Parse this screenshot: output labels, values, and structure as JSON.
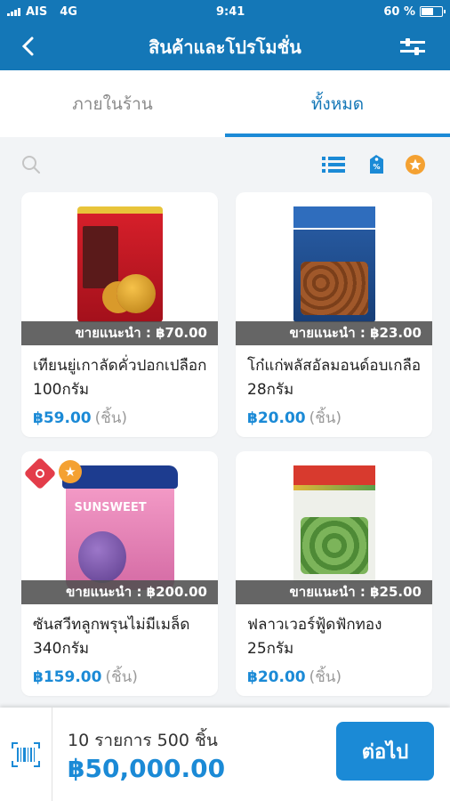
{
  "status_bar": {
    "carrier": "AIS",
    "network": "4G",
    "time": "9:41",
    "battery": "60 %",
    "battery_level": 0.6
  },
  "header": {
    "title": "สินค้าและโปรโมชั่น"
  },
  "tabs": [
    {
      "label": "ภายในร้าน",
      "active": false
    },
    {
      "label": "ทั้งหมด",
      "active": true
    }
  ],
  "products": [
    {
      "name": "เทียนยู่เกาลัดคั่วปอกเปลือก 100กรัม",
      "recommended": "ขายแนะนำ : ฿70.00",
      "price": "฿59.00",
      "unit": "(ชิ้น)"
    },
    {
      "name": "โก๋แก่พลัสอัลมอนด์อบเกลือ 28กรัม",
      "recommended": "ขายแนะนำ : ฿23.00",
      "price": "฿20.00",
      "unit": "(ชิ้น)"
    },
    {
      "name": "ซันสวีทลูกพรุนไม่มีเมล็ด 340กรัม",
      "recommended": "ขายแนะนำ : ฿200.00",
      "price": "฿159.00",
      "unit": "(ชิ้น)"
    },
    {
      "name": "ฟลาวเวอร์ฟู้ดฟักทอง 25กรัม",
      "recommended": "ขายแนะนำ : ฿25.00",
      "price": "฿20.00",
      "unit": "(ชิ้น)"
    }
  ],
  "package_text": {
    "brand_prune": "SUNSWEET"
  },
  "bottom": {
    "summary": "10 รายการ 500 ชิ้น",
    "total": "฿50,000.00",
    "next_label": "ต่อไป"
  },
  "colors": {
    "primary": "#1477b7",
    "accent": "#1b8ad6",
    "star": "#f4a132",
    "promo": "#e33d4a"
  },
  "icons": [
    "back-chevron",
    "filter-sliders",
    "search",
    "list",
    "price-tag",
    "star",
    "barcode-scan"
  ]
}
